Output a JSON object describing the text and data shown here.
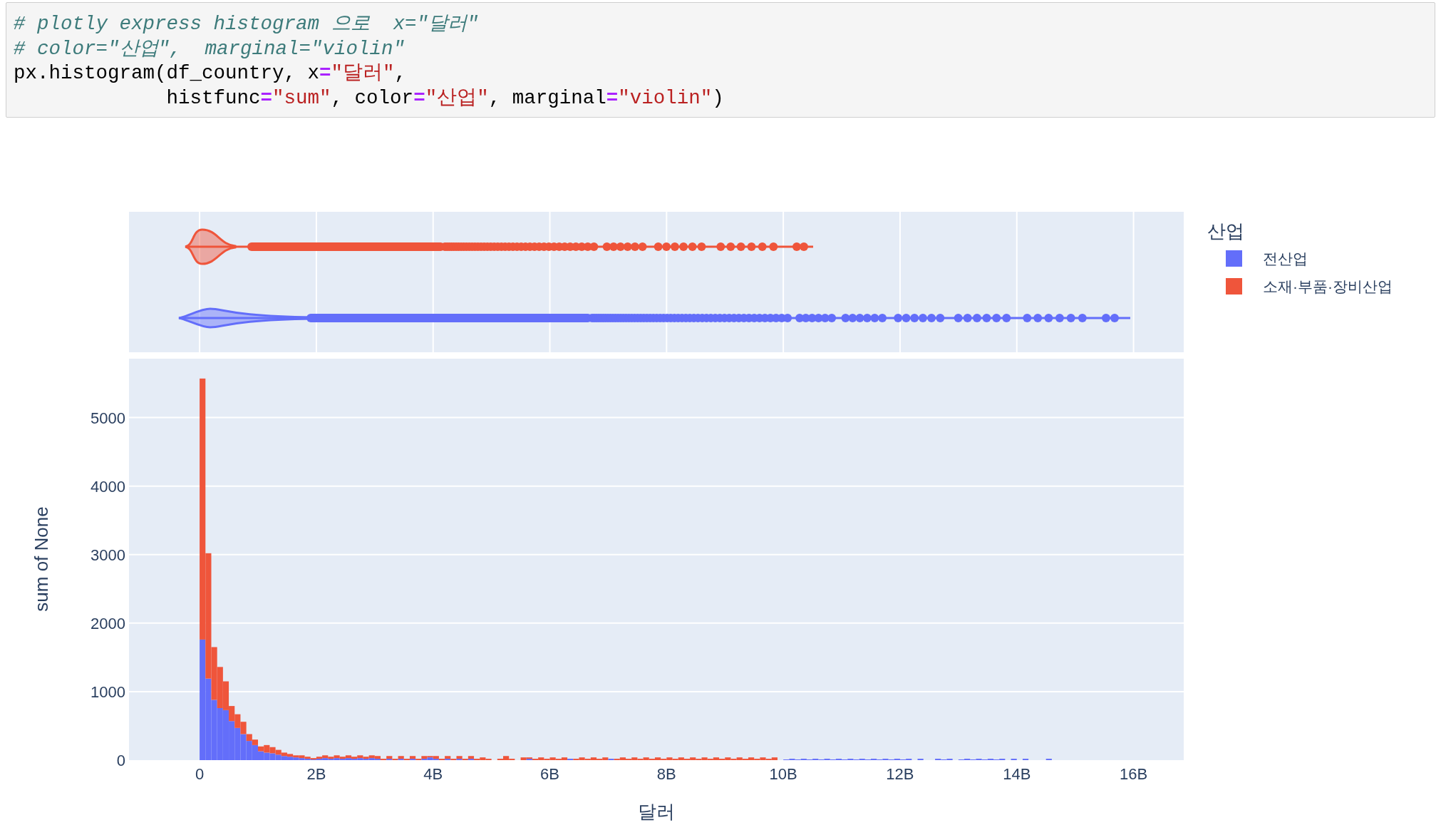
{
  "cell": {
    "code_lines": [
      [
        {
          "kind": "comment",
          "text": "# plotly express histogram 으로  x=\"달러\""
        }
      ],
      [
        {
          "kind": "comment",
          "text": "# color=\"산업\",  marginal=\"violin\""
        }
      ],
      [
        {
          "kind": "name",
          "text": "px.histogram(df_country, x"
        },
        {
          "kind": "operator",
          "text": "="
        },
        {
          "kind": "string",
          "text": "\"달러\""
        },
        {
          "kind": "name",
          "text": ","
        }
      ],
      [
        {
          "kind": "name",
          "text": "             histfunc"
        },
        {
          "kind": "operator",
          "text": "="
        },
        {
          "kind": "string",
          "text": "\"sum\""
        },
        {
          "kind": "name",
          "text": ", color"
        },
        {
          "kind": "operator",
          "text": "="
        },
        {
          "kind": "string",
          "text": "\"산업\""
        },
        {
          "kind": "name",
          "text": ", marginal"
        },
        {
          "kind": "operator",
          "text": "="
        },
        {
          "kind": "string",
          "text": "\"violin\""
        },
        {
          "kind": "name",
          "text": ")"
        }
      ]
    ]
  },
  "figure": {
    "chart_data": {
      "type": "bar",
      "stacked": true,
      "orientation": "vertical",
      "xlabel": "달러",
      "ylabel": "sum of None",
      "grid": true,
      "legend": {
        "title": "산업"
      },
      "xlim": [
        -1.21,
        16.86
      ],
      "ylim": [
        0,
        5860
      ],
      "xticks": [
        {
          "value": 0,
          "label": "0"
        },
        {
          "value": 2,
          "label": "2B"
        },
        {
          "value": 4,
          "label": "4B"
        },
        {
          "value": 6,
          "label": "6B"
        },
        {
          "value": 8,
          "label": "8B"
        },
        {
          "value": 10,
          "label": "10B"
        },
        {
          "value": 12,
          "label": "12B"
        },
        {
          "value": 14,
          "label": "14B"
        },
        {
          "value": 16,
          "label": "16B"
        }
      ],
      "yticks": [
        0,
        1000,
        2000,
        3000,
        4000,
        5000
      ],
      "x": [
        0.05,
        0.15,
        0.25,
        0.35,
        0.45,
        0.55,
        0.65,
        0.75,
        0.85,
        0.95,
        1.05,
        1.15,
        1.25,
        1.35,
        1.45,
        1.55,
        1.65,
        1.75,
        1.85,
        1.95,
        2.05,
        2.15,
        2.25,
        2.35,
        2.45,
        2.55,
        2.65,
        2.75,
        2.85,
        2.95,
        3.05,
        3.15,
        3.25,
        3.35,
        3.45,
        3.55,
        3.65,
        3.75,
        3.85,
        3.95,
        4.05,
        4.15,
        4.25,
        4.35,
        4.45,
        4.55,
        4.65,
        4.75,
        4.85,
        4.95,
        5.05,
        5.15,
        5.25,
        5.35,
        5.45,
        5.55,
        5.65,
        5.75,
        5.85,
        5.95,
        6.05,
        6.15,
        6.25,
        6.35,
        6.45,
        6.55,
        6.65,
        6.75,
        6.85,
        6.95,
        7.05,
        7.15,
        7.25,
        7.35,
        7.45,
        7.55,
        7.65,
        7.75,
        7.85,
        7.95,
        8.05,
        8.15,
        8.25,
        8.35,
        8.45,
        8.55,
        8.65,
        8.75,
        8.85,
        8.95,
        9.05,
        9.15,
        9.25,
        9.35,
        9.45,
        9.55,
        9.65,
        9.75,
        9.85,
        9.95,
        10.05,
        10.15,
        10.25,
        10.35,
        10.45,
        10.55,
        10.65,
        10.75,
        10.85,
        10.95,
        11.05,
        11.15,
        11.25,
        11.35,
        11.45,
        11.55,
        11.65,
        11.75,
        11.85,
        11.95,
        12.05,
        12.15,
        12.25,
        12.35,
        12.45,
        12.55,
        12.65,
        12.75,
        12.85,
        12.95,
        13.05,
        13.15,
        13.25,
        13.35,
        13.45,
        13.55,
        13.65,
        13.75,
        13.85,
        13.95,
        14.05,
        14.15,
        14.25,
        14.35,
        14.45,
        14.55
      ],
      "series": [
        {
          "name": "전산업",
          "color": "#636efa",
          "values": [
            1760,
            1190,
            880,
            760,
            730,
            570,
            470,
            380,
            280,
            220,
            130,
            110,
            100,
            80,
            60,
            50,
            40,
            30,
            20,
            10,
            20,
            30,
            20,
            30,
            20,
            30,
            20,
            30,
            20,
            30,
            20,
            0,
            20,
            0,
            20,
            0,
            20,
            0,
            20,
            40,
            20,
            0,
            20,
            0,
            20,
            0,
            20,
            0,
            0,
            0,
            0,
            0,
            0,
            0,
            0,
            0,
            20,
            0,
            0,
            0,
            0,
            0,
            0,
            20,
            0,
            0,
            0,
            0,
            0,
            0,
            20,
            0,
            0,
            0,
            0,
            0,
            0,
            0,
            0,
            0,
            0,
            0,
            0,
            0,
            0,
            0,
            0,
            0,
            0,
            0,
            0,
            0,
            0,
            0,
            0,
            0,
            0,
            0,
            0,
            0,
            10,
            20,
            10,
            20,
            10,
            20,
            10,
            20,
            10,
            20,
            10,
            20,
            10,
            20,
            10,
            20,
            10,
            20,
            10,
            20,
            10,
            20,
            0,
            20,
            0,
            0,
            20,
            10,
            20,
            0,
            10,
            20,
            10,
            20,
            10,
            20,
            10,
            20,
            0,
            20,
            0,
            20,
            0,
            0,
            0,
            20
          ]
        },
        {
          "name": "소재·부품·장비산업",
          "color": "#ef553b",
          "values": [
            3810,
            1830,
            770,
            600,
            420,
            220,
            200,
            180,
            100,
            80,
            70,
            110,
            90,
            70,
            50,
            40,
            30,
            40,
            30,
            20,
            30,
            40,
            30,
            40,
            30,
            40,
            30,
            40,
            30,
            40,
            40,
            20,
            40,
            20,
            40,
            20,
            40,
            20,
            40,
            20,
            40,
            20,
            40,
            20,
            40,
            20,
            40,
            20,
            40,
            20,
            0,
            20,
            60,
            20,
            0,
            40,
            20,
            20,
            40,
            20,
            40,
            20,
            40,
            0,
            20,
            40,
            20,
            40,
            20,
            40,
            0,
            20,
            40,
            20,
            40,
            20,
            40,
            20,
            40,
            20,
            40,
            20,
            40,
            20,
            40,
            20,
            40,
            20,
            40,
            20,
            40,
            20,
            40,
            20,
            40,
            20,
            40,
            20,
            40,
            0,
            0,
            0,
            0,
            0,
            0,
            0,
            0,
            0,
            0,
            0,
            0,
            0,
            0,
            0,
            0,
            0,
            0,
            0,
            0,
            0,
            0,
            0,
            0,
            0,
            0,
            0,
            0,
            0,
            0,
            0,
            0,
            0,
            0,
            0,
            0,
            0,
            0,
            0,
            0,
            0,
            0,
            0,
            0,
            0,
            0,
            0
          ]
        }
      ]
    }
  }
}
